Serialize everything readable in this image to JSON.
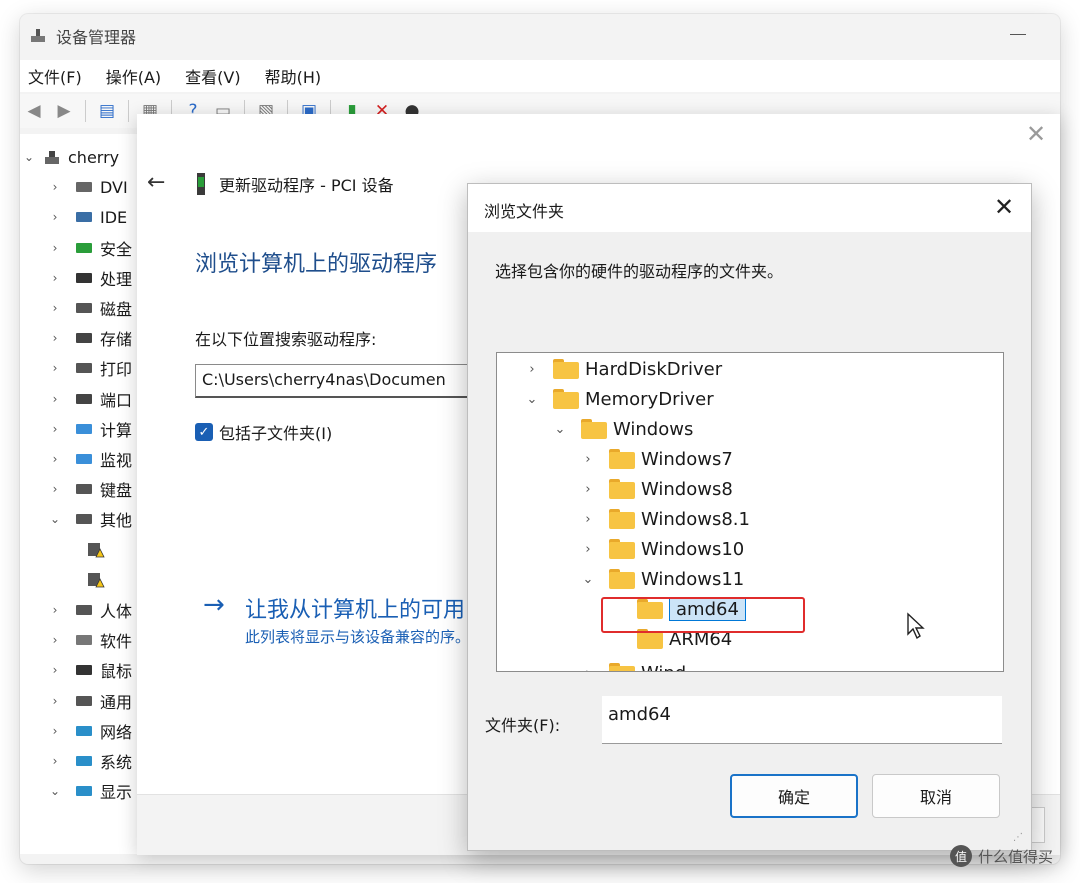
{
  "device_manager": {
    "title": "设备管理器",
    "menu": [
      "文件(F)",
      "操作(A)",
      "查看(V)",
      "帮助(H)"
    ],
    "tree": {
      "root": "cherry",
      "items": [
        "DVI",
        "IDE",
        "安全",
        "处理",
        "磁盘",
        "存储",
        "打印",
        "端口",
        "计算",
        "监视",
        "键盘",
        "其他",
        "",
        "",
        "人体",
        "软件",
        "鼠标",
        "通用",
        "网络",
        "系统",
        "显示"
      ]
    }
  },
  "update_driver": {
    "header": "更新驱动程序 - PCI 设备",
    "heading": "浏览计算机上的驱动程序",
    "search_label": "在以下位置搜索驱动程序:",
    "path_value": "C:\\Users\\cherry4nas\\Documen",
    "include_subfolders": "包括子文件夹(I)",
    "link_arrow": "→",
    "link_title": "让我从计算机上的可用",
    "link_desc": "此列表将显示与该设备兼容的序。"
  },
  "browse_folder": {
    "title": "浏览文件夹",
    "description": "选择包含你的硬件的驱动程序的文件夹。",
    "tree": [
      {
        "label": "HardDiskDriver",
        "chevron": ">"
      },
      {
        "label": "MemoryDriver",
        "chevron": "v"
      },
      {
        "label": "Windows",
        "chevron": "v"
      },
      {
        "label": "Windows7",
        "chevron": ">"
      },
      {
        "label": "Windows8",
        "chevron": ">"
      },
      {
        "label": "Windows8.1",
        "chevron": ">"
      },
      {
        "label": "Windows10",
        "chevron": ">"
      },
      {
        "label": "Windows11",
        "chevron": "v"
      },
      {
        "label": "amd64",
        "chevron": ""
      },
      {
        "label": "ARM64",
        "chevron": ""
      },
      {
        "label": "Wind",
        "chevron": ">"
      }
    ],
    "folder_label": "文件夹(F):",
    "folder_value": "amd64",
    "ok": "确定",
    "cancel": "取消"
  },
  "watermark": "什么值得买",
  "colors": {
    "accent": "#1a5fb4",
    "highlight": "#e02c2c",
    "folder": "#f7c443"
  }
}
